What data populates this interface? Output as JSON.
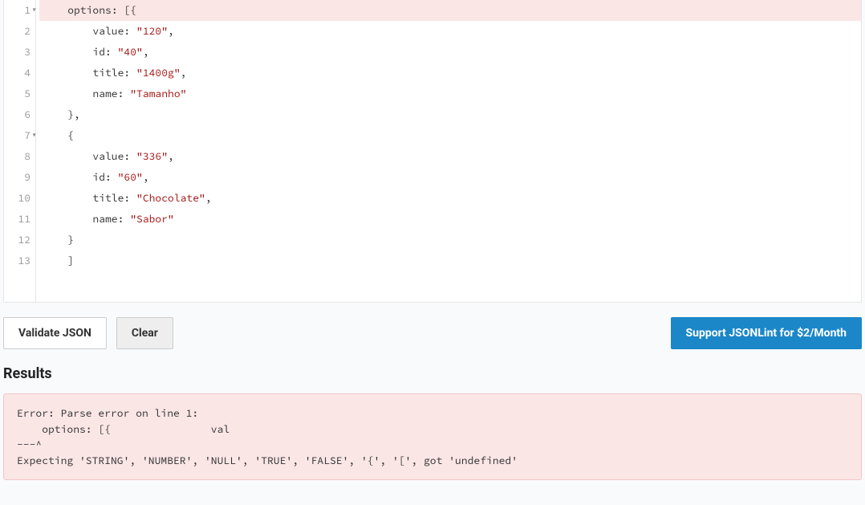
{
  "editor": {
    "lines": [
      {
        "n": 1,
        "fold": true,
        "err": true,
        "tokens": [
          [
            "    ",
            "p"
          ],
          [
            "options",
            ""
          ],
          [
            ": [{",
            "p"
          ]
        ]
      },
      {
        "n": 2,
        "fold": false,
        "err": false,
        "tokens": [
          [
            "        ",
            "p"
          ],
          [
            "value",
            ""
          ],
          [
            ": ",
            "p"
          ],
          [
            "\"120\"",
            "s"
          ],
          [
            ",",
            "p"
          ]
        ]
      },
      {
        "n": 3,
        "fold": false,
        "err": false,
        "tokens": [
          [
            "        ",
            "p"
          ],
          [
            "id",
            ""
          ],
          [
            ": ",
            "p"
          ],
          [
            "\"40\"",
            "s"
          ],
          [
            ",",
            "p"
          ]
        ]
      },
      {
        "n": 4,
        "fold": false,
        "err": false,
        "tokens": [
          [
            "        ",
            "p"
          ],
          [
            "title",
            ""
          ],
          [
            ": ",
            "p"
          ],
          [
            "\"1400g\"",
            "s"
          ],
          [
            ",",
            "p"
          ]
        ]
      },
      {
        "n": 5,
        "fold": false,
        "err": false,
        "tokens": [
          [
            "        ",
            "p"
          ],
          [
            "name",
            ""
          ],
          [
            ": ",
            "p"
          ],
          [
            "\"Tamanho\"",
            "s"
          ]
        ]
      },
      {
        "n": 6,
        "fold": false,
        "err": false,
        "tokens": [
          [
            "    },",
            "p"
          ]
        ]
      },
      {
        "n": 7,
        "fold": true,
        "err": false,
        "tokens": [
          [
            "    {",
            "p"
          ]
        ]
      },
      {
        "n": 8,
        "fold": false,
        "err": false,
        "tokens": [
          [
            "        ",
            "p"
          ],
          [
            "value",
            ""
          ],
          [
            ": ",
            "p"
          ],
          [
            "\"336\"",
            "s"
          ],
          [
            ",",
            "p"
          ]
        ]
      },
      {
        "n": 9,
        "fold": false,
        "err": false,
        "tokens": [
          [
            "        ",
            "p"
          ],
          [
            "id",
            ""
          ],
          [
            ": ",
            "p"
          ],
          [
            "\"60\"",
            "s"
          ],
          [
            ",",
            "p"
          ]
        ]
      },
      {
        "n": 10,
        "fold": false,
        "err": false,
        "tokens": [
          [
            "        ",
            "p"
          ],
          [
            "title",
            ""
          ],
          [
            ": ",
            "p"
          ],
          [
            "\"Chocolate\"",
            "s"
          ],
          [
            ",",
            "p"
          ]
        ]
      },
      {
        "n": 11,
        "fold": false,
        "err": false,
        "tokens": [
          [
            "        ",
            "p"
          ],
          [
            "name",
            ""
          ],
          [
            ": ",
            "p"
          ],
          [
            "\"Sabor\"",
            "s"
          ]
        ]
      },
      {
        "n": 12,
        "fold": false,
        "err": false,
        "tokens": [
          [
            "    }",
            "p"
          ]
        ]
      },
      {
        "n": 13,
        "fold": false,
        "err": false,
        "tokens": [
          [
            "    ]",
            "p"
          ]
        ]
      }
    ]
  },
  "toolbar": {
    "validate_label": "Validate JSON",
    "clear_label": "Clear",
    "support_label": "Support JSONLint for $2/Month"
  },
  "results": {
    "heading": "Results",
    "error_text": "Error: Parse error on line 1:\n    options: [{                val\n---^\nExpecting 'STRING', 'NUMBER', 'NULL', 'TRUE', 'FALSE', '{', '[', got 'undefined'"
  }
}
